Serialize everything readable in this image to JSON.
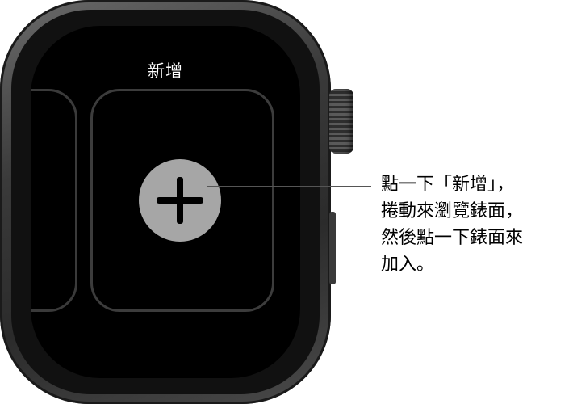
{
  "screen": {
    "title": "新增"
  },
  "callout": {
    "text": "點一下「新增」，\n捲動來瀏覽錶面，\n然後點一下錶面來\n加入。"
  },
  "icons": {
    "add": "plus-icon",
    "crown": "digital-crown"
  },
  "colors": {
    "screen_background": "#000000",
    "add_button": "#a6a6a6",
    "card_border": "#3c3c3c",
    "title_text": "#ffffff"
  }
}
